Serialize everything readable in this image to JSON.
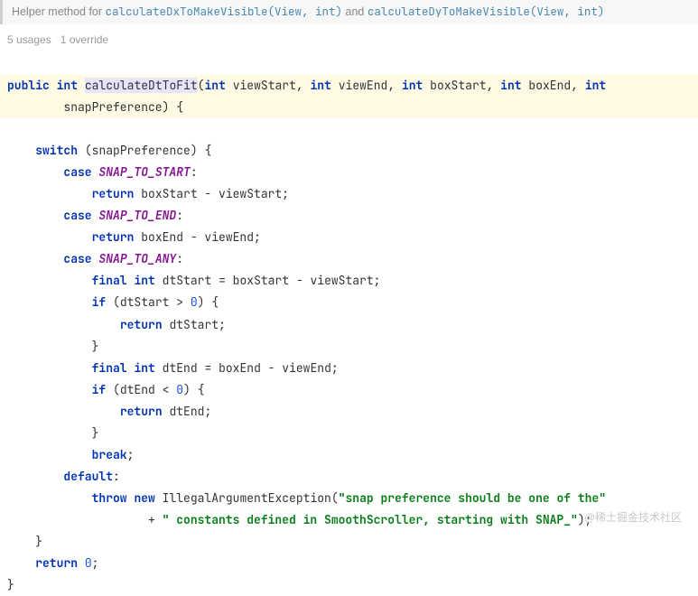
{
  "doc": {
    "prefix": "Helper method for ",
    "link1": "calculateDxToMakeVisible(View, int)",
    "middle": " and ",
    "link2": "calculateDyToMakeVisible(View, int)"
  },
  "usage": {
    "usages": "5 usages",
    "overrides": "1 override"
  },
  "code": {
    "kw_public": "public",
    "kw_int": "int",
    "method_name": "calculateDtToFit",
    "p_viewStart": "viewStart",
    "p_viewEnd": "viewEnd",
    "p_boxStart": "boxStart",
    "p_boxEnd": "boxEnd",
    "p_snapPreference": "snapPreference",
    "kw_switch": "switch",
    "kw_case": "case",
    "snap_start": "SNAP_TO_START",
    "snap_end": "SNAP_TO_END",
    "snap_any": "SNAP_TO_ANY",
    "kw_return": "return",
    "expr1": "boxStart - viewStart;",
    "expr2": "boxEnd - viewEnd;",
    "kw_final": "final",
    "var_dtStart": "dtStart",
    "assign1": " = boxStart - viewStart;",
    "kw_if": "if",
    "cond1_a": "(dtStart > ",
    "zero": "0",
    "cond_close": ") {",
    "ret_dtStart": "dtStart;",
    "var_dtEnd": "dtEnd",
    "assign2": " = boxEnd - viewEnd;",
    "cond2_a": "(dtEnd < ",
    "ret_dtEnd": "dtEnd;",
    "kw_break": "break",
    "kw_default": "default",
    "kw_throw": "throw",
    "kw_new": "new",
    "exc_class": "IllegalArgumentException",
    "str1": "\"snap preference should be one of the\"",
    "str2": "\" constants defined in SmoothScroller, starting with SNAP_\"",
    "ret_zero": "0",
    "semi": ";",
    "colon": ":",
    "lbrace": "{",
    "rbrace": "}",
    "lparen": "(",
    "rparen": ")",
    "comma": ", ",
    "plus": "+ "
  },
  "watermark": "@稀土掘金技术社区"
}
